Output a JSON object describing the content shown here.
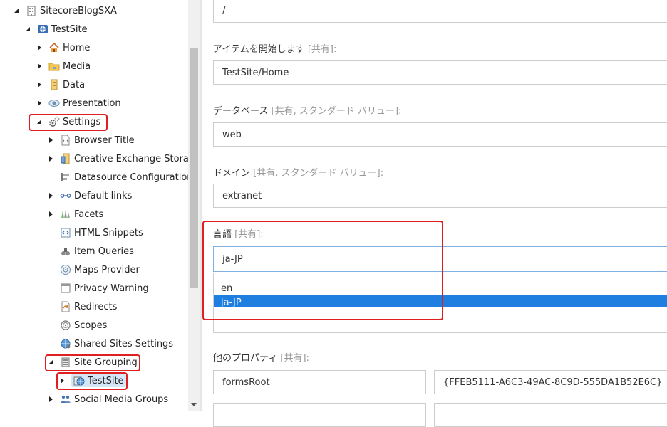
{
  "tree": {
    "nodes": [
      {
        "label": "SitecoreBlogSXA",
        "icon": "building-icon"
      },
      {
        "label": "TestSite",
        "icon": "site-globe-icon"
      },
      {
        "label": "Home",
        "icon": "home-icon"
      },
      {
        "label": "Media",
        "icon": "folder-icon"
      },
      {
        "label": "Data",
        "icon": "database-icon"
      },
      {
        "label": "Presentation",
        "icon": "eye-icon"
      },
      {
        "label": "Settings",
        "icon": "gears-icon"
      },
      {
        "label": "Browser Title",
        "icon": "page-code-icon"
      },
      {
        "label": "Creative Exchange Storages",
        "icon": "storage-icon"
      },
      {
        "label": "Datasource Configurations",
        "icon": "config-icon"
      },
      {
        "label": "Default links",
        "icon": "link-icon"
      },
      {
        "label": "Facets",
        "icon": "facets-icon"
      },
      {
        "label": "HTML Snippets",
        "icon": "html-icon"
      },
      {
        "label": "Item Queries",
        "icon": "query-icon"
      },
      {
        "label": "Maps Provider",
        "icon": "map-icon"
      },
      {
        "label": "Privacy Warning",
        "icon": "privacy-icon"
      },
      {
        "label": "Redirects",
        "icon": "redirect-icon"
      },
      {
        "label": "Scopes",
        "icon": "scope-icon"
      },
      {
        "label": "Shared Sites Settings",
        "icon": "shared-globe-icon"
      },
      {
        "label": "Site Grouping",
        "icon": "grouping-icon"
      },
      {
        "label": "TestSite",
        "icon": "site-globe-icon"
      },
      {
        "label": "Social Media Groups",
        "icon": "people-icon"
      }
    ]
  },
  "form": {
    "top_value": "/",
    "start_item": {
      "label": "アイテムを開始します",
      "meta": "[共有]:",
      "value": "TestSite/Home"
    },
    "database": {
      "label": "データベース",
      "meta": "[共有, スタンダード バリュー]:",
      "value": "web"
    },
    "domain": {
      "label": "ドメイン",
      "meta": "[共有, スタンダード バリュー]:",
      "value": "extranet"
    },
    "language": {
      "label": "言語",
      "meta": "[共有]:",
      "value": "ja-JP",
      "options": [
        "en",
        "ja-JP"
      ]
    },
    "other_props": {
      "label": "他のプロパティ",
      "meta": "[共有]:",
      "key": "formsRoot",
      "value": "{FFEB5111-A6C3-49AC-8C9D-555DA1B52E6C}"
    }
  },
  "colors": {
    "highlight": "#e02020",
    "selection": "#1e7fe0"
  }
}
